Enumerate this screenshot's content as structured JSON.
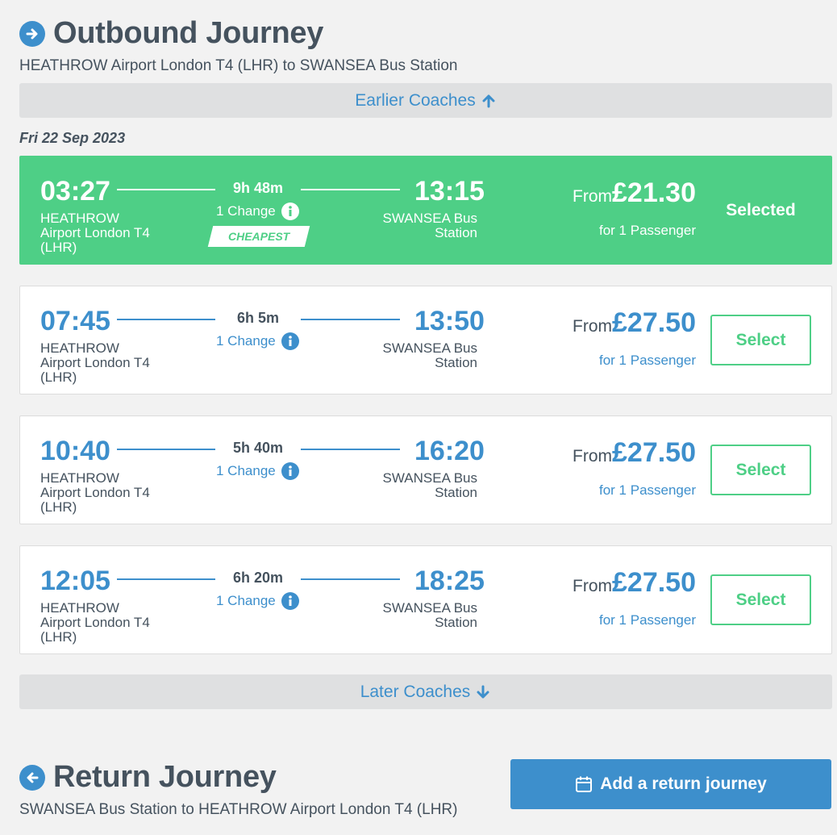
{
  "outbound": {
    "title": "Outbound Journey",
    "icon": "arrow-right-circle-icon",
    "route": "HEATHROW Airport London T4 (LHR) to SWANSEA Bus Station"
  },
  "earlier_label": "Earlier Coaches",
  "date": "Fri 22 Sep 2023",
  "journeys": [
    {
      "dep_time": "03:27",
      "dep_stop": "HEATHROW Airport London T4 (LHR)",
      "duration": "9h 48m",
      "changes": "1 Change",
      "arr_time": "13:15",
      "arr_stop": "SWANSEA Bus Station",
      "from": "From",
      "price": "£21.30",
      "passengers": "for 1 Passenger",
      "badge": "CHEAPEST",
      "status": "Selected"
    },
    {
      "dep_time": "07:45",
      "dep_stop": "HEATHROW Airport London T4 (LHR)",
      "duration": "6h 5m",
      "changes": "1 Change",
      "arr_time": "13:50",
      "arr_stop": "SWANSEA Bus Station",
      "from": "From",
      "price": "£27.50",
      "passengers": "for 1 Passenger",
      "button": "Select"
    },
    {
      "dep_time": "10:40",
      "dep_stop": "HEATHROW Airport London T4 (LHR)",
      "duration": "5h 40m",
      "changes": "1 Change",
      "arr_time": "16:20",
      "arr_stop": "SWANSEA Bus Station",
      "from": "From",
      "price": "£27.50",
      "passengers": "for 1 Passenger",
      "button": "Select"
    },
    {
      "dep_time": "12:05",
      "dep_stop": "HEATHROW Airport London T4 (LHR)",
      "duration": "6h 20m",
      "changes": "1 Change",
      "arr_time": "18:25",
      "arr_stop": "SWANSEA Bus Station",
      "from": "From",
      "price": "£27.50",
      "passengers": "for 1 Passenger",
      "button": "Select"
    }
  ],
  "later_label": "Later Coaches",
  "return": {
    "title": "Return Journey",
    "icon": "arrow-left-circle-icon",
    "route": "SWANSEA Bus Station to HEATHROW Airport London T4 (LHR)",
    "add_label": "Add a return journey"
  },
  "colors": {
    "accent": "#3d8fcc",
    "selected": "#4ecf86",
    "text": "#45525e",
    "background": "#f2f2f2"
  }
}
